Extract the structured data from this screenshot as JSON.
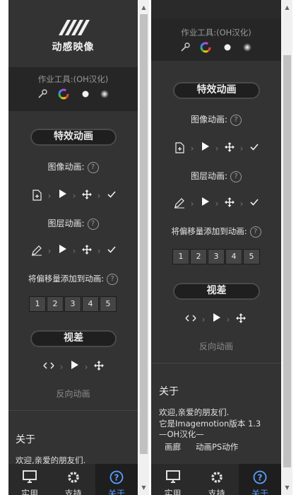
{
  "brand": {
    "name": "动感映像"
  },
  "tools": {
    "title": "作业工具:(OH汉化)",
    "icons": [
      "wrench-icon",
      "color-wheel-icon",
      "white-dot-icon",
      "soft-glow-icon"
    ]
  },
  "effects": {
    "section_label": "特效动画",
    "image_anim_label": "图像动画:",
    "layer_anim_label": "图层动画:",
    "offset_label": "将偏移量添加到动画:",
    "offset_values": [
      "1",
      "2",
      "3",
      "4",
      "5"
    ],
    "help": "?"
  },
  "parallax": {
    "section_label": "视差",
    "reverse_label": "反向动画"
  },
  "about": {
    "title": "关于",
    "welcome": "欢迎,亲爱的朋友们.",
    "version": "它是Imagemotion版本 1.3",
    "credit": "—OH汉化—",
    "link_gallery": "画廊",
    "link_actions": "动画PS动作"
  },
  "bottom_nav": {
    "tabs": [
      {
        "label": "实用",
        "icon": "monitor-icon"
      },
      {
        "label": "支持",
        "icon": "gear-icon"
      },
      {
        "label": "关于",
        "icon": "help-circle-icon"
      }
    ]
  },
  "colors": {
    "panel_bg": "#333333",
    "tools_bg": "#262626",
    "accent": "#5aa0ff"
  }
}
